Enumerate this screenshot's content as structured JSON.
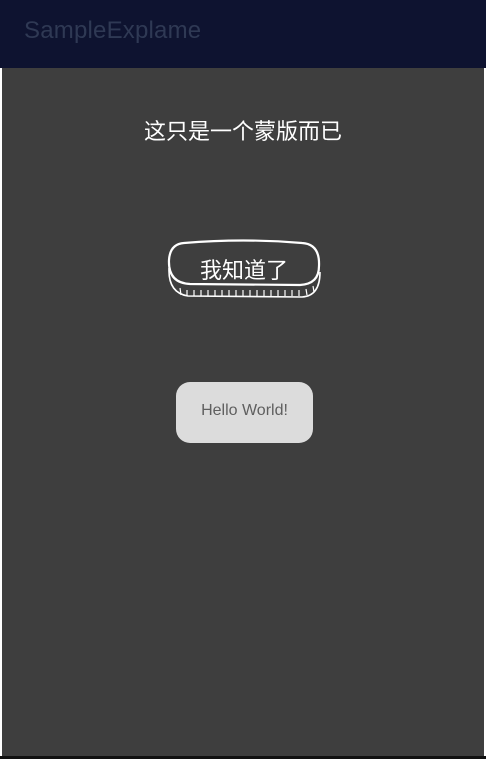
{
  "app_bar": {
    "title": "SampleExplame",
    "background_color": "#0e1330",
    "title_color": "#2f3954"
  },
  "overlay": {
    "background_color": "#3e3e3e",
    "hint_text": "这只是一个蒙版而已",
    "dismiss_button_label": "我知道了",
    "dismiss_button_icon": "hand-drawn-outline"
  },
  "content": {
    "hello_button_label": "Hello World!",
    "hello_button_color": "#dcdcdc"
  }
}
